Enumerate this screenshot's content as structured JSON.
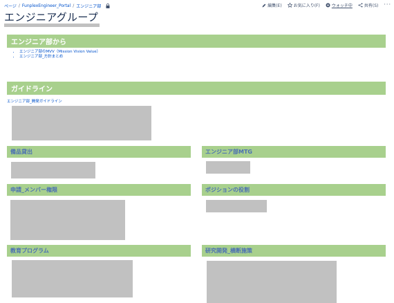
{
  "breadcrumb": {
    "items": [
      "ページ",
      "FunplexEngineer_Portal",
      "エンジニア部"
    ]
  },
  "actions": {
    "edit": "編集(E)",
    "favorite": "お気に入り(F)",
    "watch": "ウォッチ中",
    "share": "共有(S)",
    "more": "···"
  },
  "page": {
    "title": "エンジニアグループ"
  },
  "sections": {
    "from_eng": {
      "title": "エンジニア部から",
      "links": [
        "エンジニア部のMVV（Mission Vision Value）",
        "エンジニア部_方針まとめ"
      ]
    },
    "guidelines": {
      "title": "ガイドライン",
      "link": "エンジニア部_開発ガイドライン"
    },
    "equipment": {
      "title": "備品貸出"
    },
    "eng_mtg": {
      "title": "エンジニア部MTG"
    },
    "apply": {
      "title": "申請_メンバー権限"
    },
    "positions": {
      "title": "ポジションの役割"
    },
    "education": {
      "title": "教育プログラム"
    },
    "rnd": {
      "title": "研究開発_横断施策"
    }
  },
  "colors": {
    "section_bg": "#a8d08d",
    "link": "#0052cc",
    "placeholder": "#c1c1c1"
  }
}
